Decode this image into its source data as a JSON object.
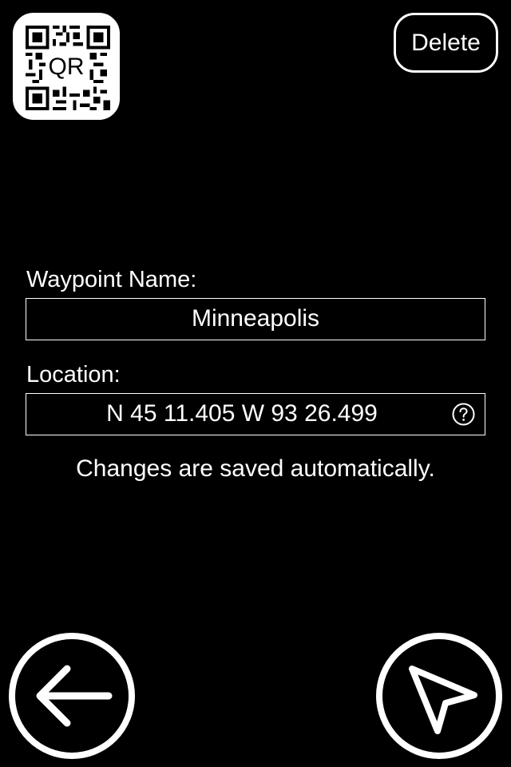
{
  "header": {
    "qr_label": "QR",
    "delete_label": "Delete"
  },
  "form": {
    "name_label": "Waypoint Name:",
    "name_value": "Minneapolis",
    "location_label": "Location:",
    "location_value": "N 45 11.405 W 93 26.499",
    "hint": "Changes are saved automatically."
  },
  "icons": {
    "qr": "qr-code-icon",
    "help": "question-circle-icon",
    "back": "arrow-left-icon",
    "navigate": "navigation-arrow-icon"
  },
  "colors": {
    "background": "#000000",
    "foreground": "#ffffff"
  }
}
